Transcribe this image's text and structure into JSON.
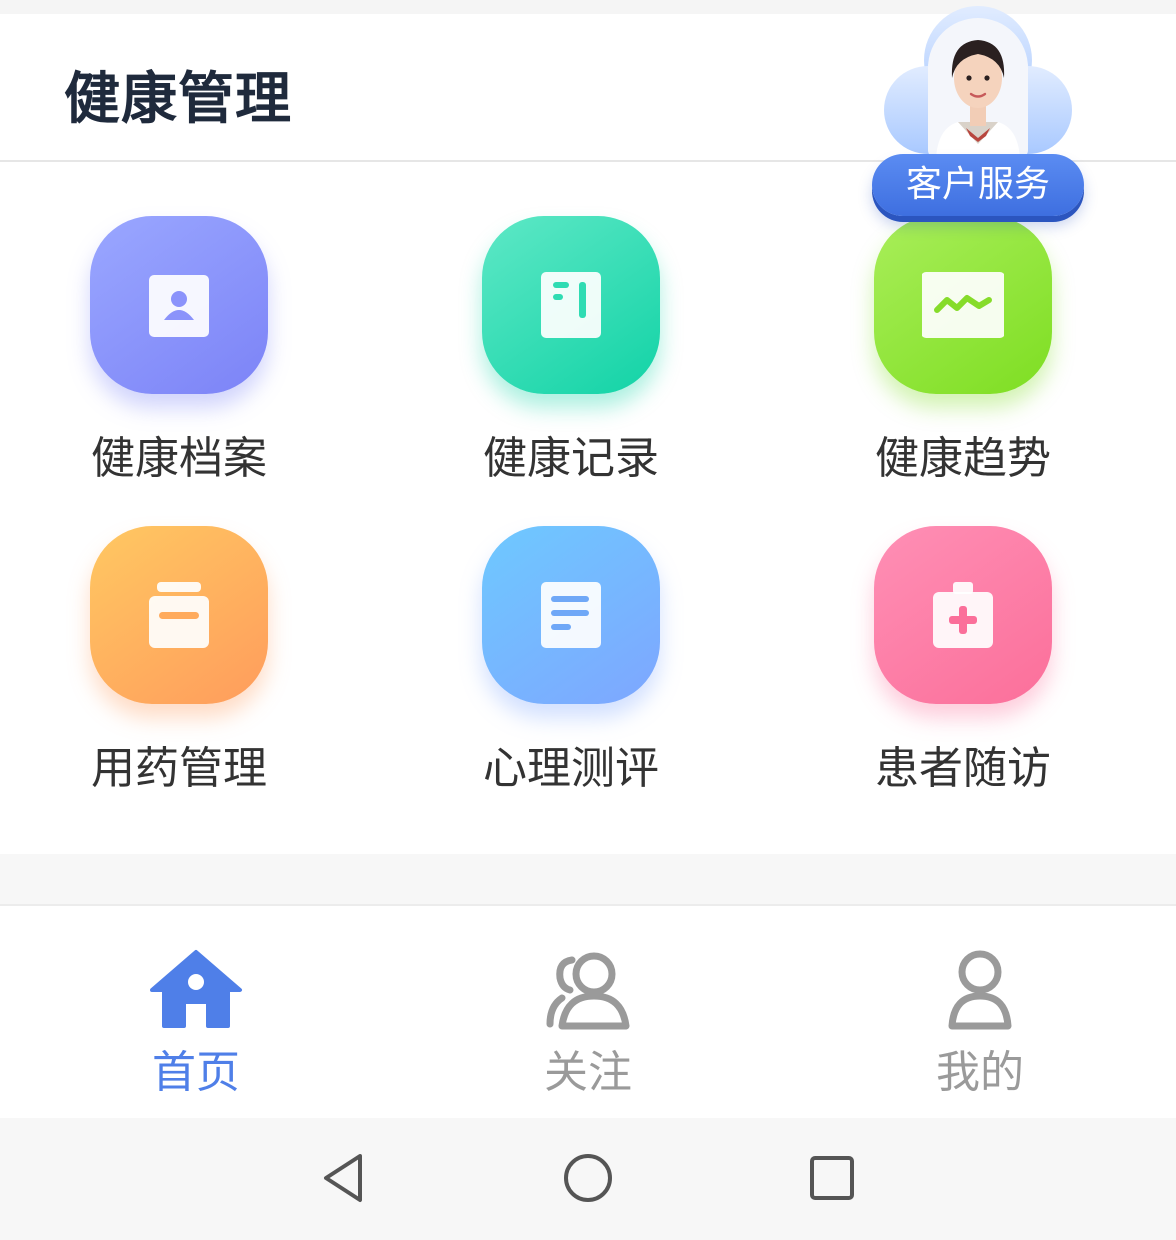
{
  "header": {
    "title": "健康管理"
  },
  "service": {
    "label": "客户服务"
  },
  "tiles": [
    {
      "label": "健康档案",
      "icon": "profile-card-icon",
      "color": "#8b93fb"
    },
    {
      "label": "健康记录",
      "icon": "notebook-icon",
      "color": "#2fdcb3"
    },
    {
      "label": "健康趋势",
      "icon": "trend-chart-icon",
      "color": "#92e53d"
    },
    {
      "label": "用药管理",
      "icon": "medicine-bottle-icon",
      "color": "#ffb25f"
    },
    {
      "label": "心理测评",
      "icon": "document-icon",
      "color": "#76b6ff"
    },
    {
      "label": "患者随访",
      "icon": "medical-kit-icon",
      "color": "#fd7ea7"
    }
  ],
  "tabbar": {
    "items": [
      {
        "label": "首页",
        "icon": "home-icon",
        "active": true
      },
      {
        "label": "关注",
        "icon": "people-icon",
        "active": false
      },
      {
        "label": "我的",
        "icon": "user-icon",
        "active": false
      }
    ],
    "active_color": "#4f7fe8",
    "inactive_color": "#9a9a9a"
  },
  "navbar": {
    "icons": [
      "back-triangle-icon",
      "home-circle-icon",
      "recents-square-icon"
    ]
  }
}
